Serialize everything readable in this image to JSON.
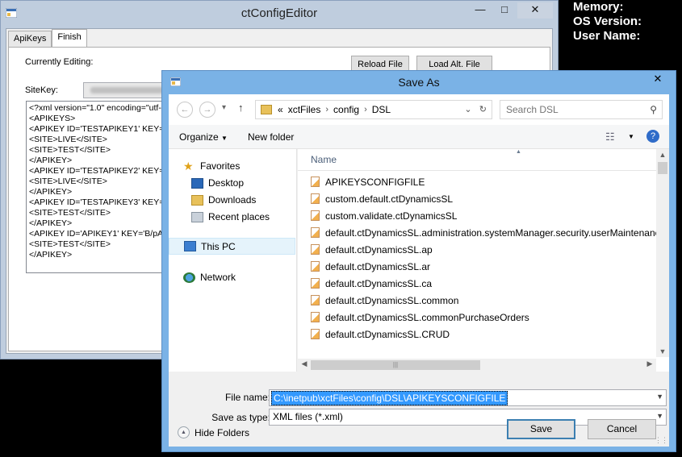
{
  "sysinfo": [
    "Memory:",
    "OS Version:",
    "User Name:"
  ],
  "editor": {
    "title": "ctConfigEditor",
    "tabs": [
      "ApiKeys",
      "Finish"
    ],
    "currently_editing_label": "Currently Editing:",
    "reload_button": "Reload File",
    "load_alt_button": "Load Alt. File",
    "sitekey_label": "SiteKey:",
    "xml_lines": [
      "<?xml version=\"1.0\" encoding=\"utf-",
      "<APIKEYS>",
      "<APIKEY ID='TESTAPIKEY1' KEY=",
      "<SITE>LIVE</SITE>",
      "<SITE>TEST</SITE>",
      "</APIKEY>",
      "<APIKEY ID='TESTAPIKEY2' KEY=",
      "<SITE>LIVE</SITE>",
      "</APIKEY>",
      "<APIKEY ID='TESTAPIKEY3' KEY=",
      "<SITE>TEST</SITE>",
      "</APIKEY>",
      "<APIKEY ID='APIKEY1' KEY='B/pA",
      "<SITE>TEST</SITE>",
      "</APIKEY>"
    ]
  },
  "dialog": {
    "title": "Save As",
    "breadcrumb": {
      "prefix": "«",
      "parts": [
        "xctFiles",
        "config",
        "DSL"
      ]
    },
    "search_placeholder": "Search DSL",
    "toolbar": {
      "organize": "Organize",
      "new_folder": "New folder"
    },
    "nav": {
      "favorites": "Favorites",
      "desktop": "Desktop",
      "downloads": "Downloads",
      "recent": "Recent places",
      "this_pc": "This PC",
      "network": "Network"
    },
    "column_name": "Name",
    "files": [
      "APIKEYSCONFIGFILE",
      "custom.default.ctDynamicsSL",
      "custom.validate.ctDynamicsSL",
      "default.ctDynamicsSL.administration.systemManager.security.userMaintenance",
      "default.ctDynamicsSL.ap",
      "default.ctDynamicsSL.ar",
      "default.ctDynamicsSL.ca",
      "default.ctDynamicsSL.common",
      "default.ctDynamicsSL.commonPurchaseOrders",
      "default.ctDynamicsSL.CRUD"
    ],
    "file_name_label": "File name:",
    "file_name_value": "C:\\inetpub\\xctFiles\\config\\DSL\\APIKEYSCONFIGFILE",
    "save_type_label": "Save as type:",
    "save_type_value": "XML files (*.xml)",
    "hide_folders": "Hide Folders",
    "save_button": "Save",
    "cancel_button": "Cancel"
  }
}
